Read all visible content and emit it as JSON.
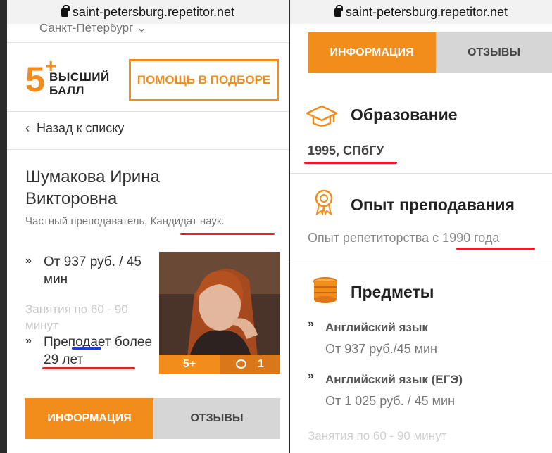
{
  "left_panel": {
    "url": "saint-petersburg.repetitor.net",
    "city": "Санкт-Петербург",
    "logo": {
      "number": "5",
      "plus": "+",
      "line1": "ВЫСШИЙ",
      "line2": "БАЛЛ"
    },
    "help_button": "ПОМОЩЬ В ПОДБОРЕ",
    "back_link": "Назад к списку",
    "tutor_name": "Шумакова Ирина Викторовна",
    "subtitle": "Частный преподаватель, Кандидат наук.",
    "bullet_glyph": "»",
    "price": "От 937 руб. / 45 мин",
    "lessons": "Занятия по 60 - 90 минут",
    "experience": "Преподает более 29 лет",
    "photo_stats": {
      "rating": "5+",
      "reviews": "1"
    },
    "tabs": {
      "info": "ИНФОРМАЦИЯ",
      "reviews": "ОТЗЫВЫ"
    }
  },
  "right_panel": {
    "url": "saint-petersburg.repetitor.net",
    "tabs": {
      "info": "ИНФОРМАЦИЯ",
      "reviews": "ОТЗЫВЫ"
    },
    "education": {
      "icon": "graduation-cap-icon",
      "title": "Образование",
      "value": "1995, СПбГУ"
    },
    "experience": {
      "icon": "award-medal-icon",
      "title": "Опыт преподавания",
      "text": "Опыт репетиторства с 1990 года"
    },
    "subjects": {
      "icon": "coins-icon",
      "title": "Предметы",
      "bullet_glyph": "»",
      "items": [
        {
          "name": "Английский язык",
          "price": "От 937 руб./45 мин"
        },
        {
          "name": "Английский язык (ЕГЭ)",
          "price": "От 1 025 руб. / 45 мин"
        }
      ],
      "lessons": "Занятия по 60 - 90 минут"
    }
  },
  "colors": {
    "accent": "#f28c1b",
    "annotation_red": "#e31e24",
    "annotation_blue": "#1a3fd0"
  }
}
